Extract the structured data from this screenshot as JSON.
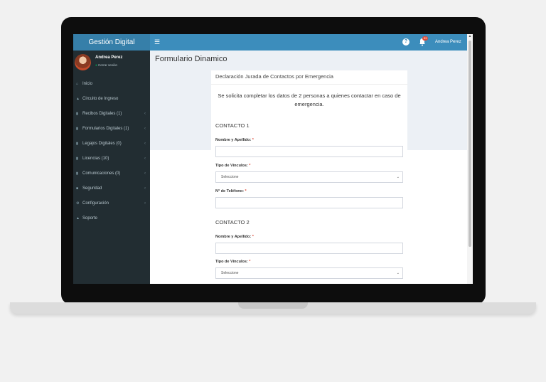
{
  "app": {
    "brand": "Gestión Digital"
  },
  "topbar": {
    "menu_icon": "hamburger-icon",
    "help_icon": "question-icon",
    "notifications_icon": "bell-icon",
    "notification_count": "99",
    "user_name": "Andrea Perez"
  },
  "sidebar": {
    "user_name": "Andrea Perez",
    "logout": "Cerrar sesión",
    "items": [
      {
        "label": "Inicio",
        "icon": "home-icon"
      },
      {
        "label": "Circuito de Ingreso",
        "icon": "sitemap-icon"
      },
      {
        "label": "Recibos Digitales (1)",
        "icon": "file-icon"
      },
      {
        "label": "Formularios Digitales (1)",
        "icon": "file-icon"
      },
      {
        "label": "Legajos Digitales (0)",
        "icon": "file-icon"
      },
      {
        "label": "Licencias (10)",
        "icon": "file-icon"
      },
      {
        "label": "Comunicaciones (0)",
        "icon": "file-icon"
      },
      {
        "label": "Seguridad",
        "icon": "lock-icon"
      },
      {
        "label": "Configuración",
        "icon": "gear-icon"
      },
      {
        "label": "Soporte",
        "icon": "sitemap-icon"
      }
    ]
  },
  "main": {
    "page_title": "Formulario Dinamico",
    "card_title": "Declaración Jurada de Contactos por Emergencia",
    "intro": "Se solicita completar los datos de 2 personas a quienes contactar en caso de emergencia.",
    "contact1": {
      "title": "CONTACTO 1",
      "name_label": "Nombre y Apellido:",
      "link_label": "Tipo de Vínculos:",
      "link_value": "Seleccione",
      "phone_label": "N° de Teléfono:"
    },
    "contact2": {
      "title": "CONTACTO 2",
      "name_label": "Nombre y Apellido:",
      "link_label": "Tipo de Vínculos:",
      "link_value": "Seleccione"
    },
    "required_mark": "*"
  },
  "colors": {
    "topbar": "#3c8dbc",
    "brand": "#367fa9",
    "sidebar": "#222d32",
    "content_bg": "#ecf0f5",
    "required": "#dd4b39"
  }
}
